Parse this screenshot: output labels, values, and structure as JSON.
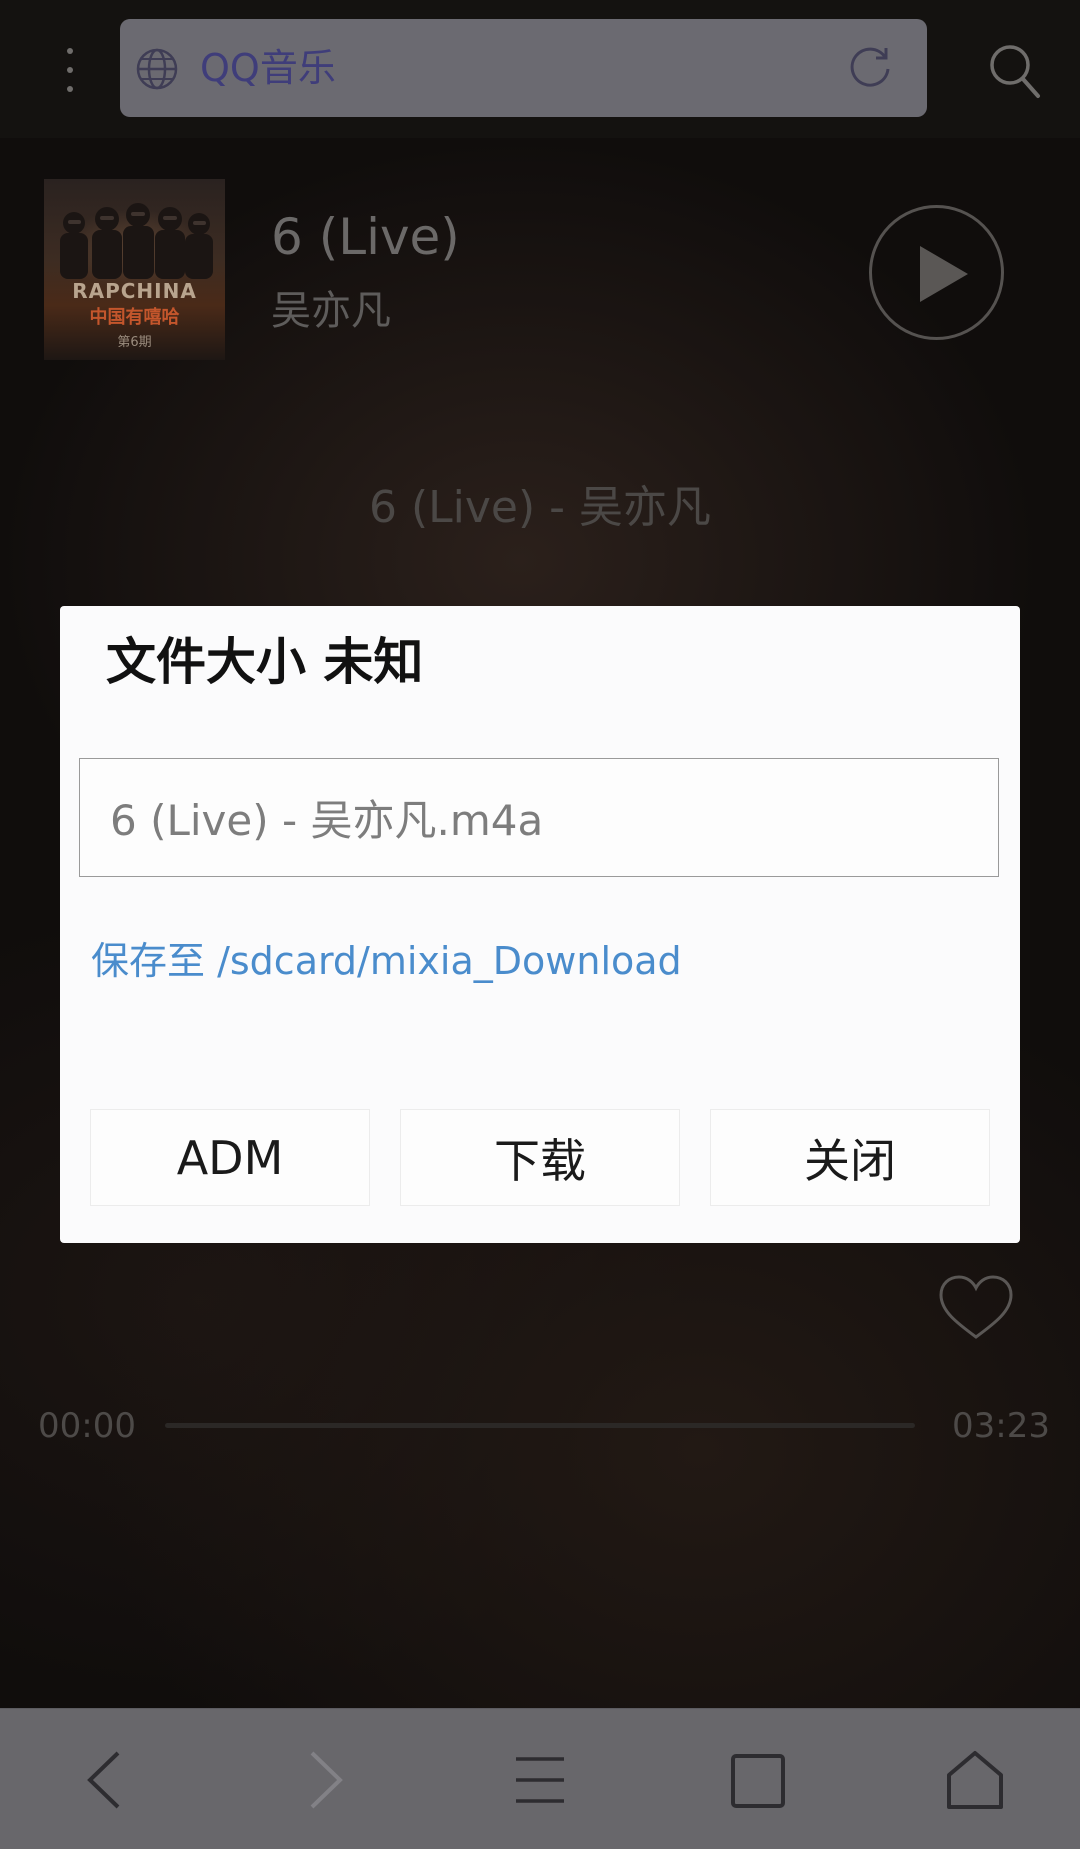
{
  "browser": {
    "url_text": "QQ音乐"
  },
  "player": {
    "album_art_text": {
      "title": "RAPCHINA",
      "subtitle": "中国有嘻哈",
      "episode": "第6期"
    },
    "song_title": "6 (Live)",
    "artist": "吴亦凡",
    "lyric": "6 (Live) - 吴亦凡",
    "time_current": "00:00",
    "time_total": "03:23",
    "progress": 0
  },
  "dialog": {
    "title": "文件大小 未知",
    "filename": "6 (Live) - 吴亦凡.m4a",
    "save_path": "保存至 /sdcard/mixia_Download",
    "buttons": {
      "adm": "ADM",
      "download": "下载",
      "close": "关闭"
    }
  },
  "colors": {
    "link": "#4a8ccc",
    "url_text": "#3f3d7a",
    "nav_bar": "#68676b"
  },
  "icons": {
    "top": [
      "menu-dots-icon",
      "globe-icon",
      "refresh-icon",
      "search-icon"
    ],
    "player": [
      "play-icon",
      "heart-icon"
    ],
    "nav": [
      "back-icon",
      "forward-icon",
      "menu-icon",
      "tabs-icon",
      "home-icon"
    ]
  }
}
